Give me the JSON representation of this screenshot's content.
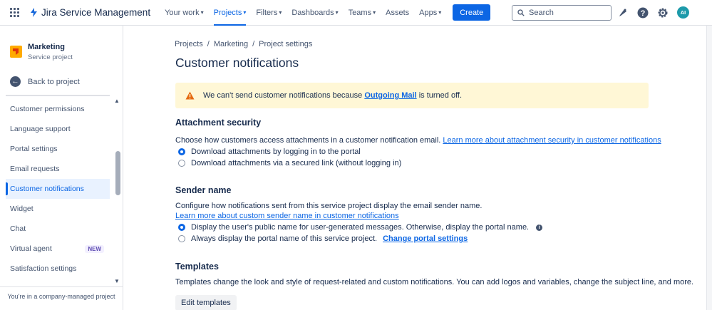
{
  "topnav": {
    "product": "Jira Service Management",
    "items": [
      {
        "label": "Your work",
        "dropdown": true
      },
      {
        "label": "Projects",
        "dropdown": true,
        "active": true
      },
      {
        "label": "Filters",
        "dropdown": true
      },
      {
        "label": "Dashboards",
        "dropdown": true
      },
      {
        "label": "Teams",
        "dropdown": true
      },
      {
        "label": "Assets",
        "dropdown": false
      },
      {
        "label": "Apps",
        "dropdown": true
      }
    ],
    "create_label": "Create",
    "search_placeholder": "Search",
    "avatar_initials": "AI"
  },
  "sidebar": {
    "project_name": "Marketing",
    "project_type": "Service project",
    "back_label": "Back to project",
    "items": [
      {
        "label": "Customer permissions"
      },
      {
        "label": "Language support"
      },
      {
        "label": "Portal settings"
      },
      {
        "label": "Email requests"
      },
      {
        "label": "Customer notifications",
        "active": true
      },
      {
        "label": "Widget"
      },
      {
        "label": "Chat"
      },
      {
        "label": "Virtual agent",
        "badge": "NEW"
      },
      {
        "label": "Satisfaction settings"
      }
    ],
    "footer": "You're in a company-managed project"
  },
  "main": {
    "breadcrumb": [
      "Projects",
      "Marketing",
      "Project settings"
    ],
    "title": "Customer notifications",
    "banner": {
      "text_before": "We can't send customer notifications because",
      "link": "Outgoing Mail",
      "text_after": "is turned off."
    },
    "attachment": {
      "heading": "Attachment security",
      "description": "Choose how customers access attachments in a customer notification email.",
      "learn_more": "Learn more about attachment security in customer notifications",
      "options": [
        {
          "label": "Download attachments by logging in to the portal",
          "checked": true
        },
        {
          "label": "Download attachments via a secured link (without logging in)",
          "checked": false
        }
      ]
    },
    "sender": {
      "heading": "Sender name",
      "description": "Configure how notifications sent from this service project display the email sender name.",
      "learn_more": "Learn more about custom sender name in customer notifications",
      "option1": "Display the user's public name for user-generated messages. Otherwise, display the portal name.",
      "option2": "Always display the portal name of this service project.",
      "option2_link": "Change portal settings"
    },
    "templates": {
      "heading": "Templates",
      "description": "Templates change the look and style of request-related and custom notifications. You can add logos and variables, change the subject line, and more.",
      "button": "Edit templates"
    }
  },
  "colors": {
    "accent": "#0C66E4",
    "banner_bg": "#FFF7D6",
    "warning": "#E56910",
    "badge": "#5E4DB2"
  }
}
